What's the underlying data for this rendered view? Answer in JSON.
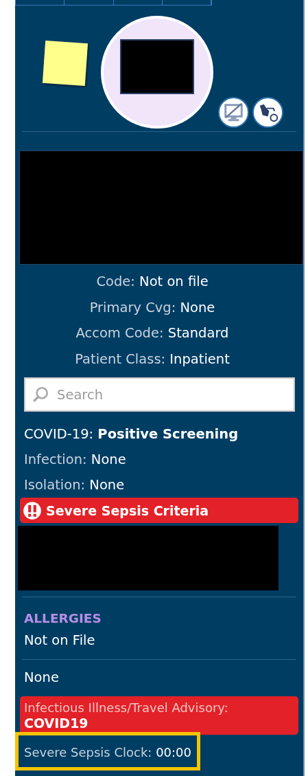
{
  "summary": [
    {
      "label": "Code:",
      "value": "Not on file"
    },
    {
      "label": "Primary Cvg:",
      "value": "None"
    },
    {
      "label": "Accom Code:",
      "value": "Standard"
    },
    {
      "label": "Patient Class:",
      "value": "Inpatient"
    }
  ],
  "search": {
    "placeholder": "Search"
  },
  "flags": [
    {
      "label": "COVID-19:",
      "value": "Positive Screening",
      "kind": "strong"
    },
    {
      "label": "Infection:",
      "value": "None",
      "kind": "plain"
    },
    {
      "label": "Isolation:",
      "value": "None",
      "kind": "plain"
    }
  ],
  "alert": {
    "text": "Severe Sepsis Criteria"
  },
  "allergies": {
    "heading": "ALLERGIES",
    "value": "Not on File"
  },
  "other": {
    "value": "None"
  },
  "advisory": {
    "label": "Infectious Illness/Travel Advisory:",
    "value": "COVID19"
  },
  "sepsis_clock": {
    "label": "Severe Sepsis Clock:",
    "value": "00:00",
    "highlighted": true
  }
}
